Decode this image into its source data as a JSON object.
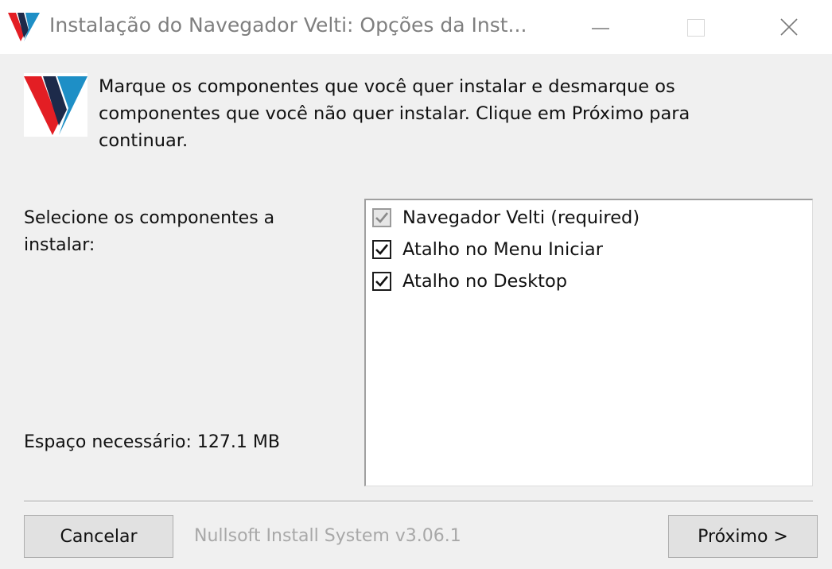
{
  "window": {
    "title": "Instalação do Navegador Velti: Opções da Inst...",
    "icon": "velti-logo-icon",
    "controls": [
      "minimize-icon",
      "maximize-icon",
      "close-icon"
    ]
  },
  "header": {
    "logo": "velti-logo",
    "description": "Marque os componentes que você quer instalar e desmarque os componentes que você não quer instalar. Clique em Próximo para continuar."
  },
  "components": {
    "select_label": "Selecione os componentes a instalar:",
    "space_required": "Espaço necessário: 127.1 MB",
    "items": [
      {
        "label": "Navegador Velti (required)",
        "checked": true,
        "disabled": true
      },
      {
        "label": "Atalho no Menu Iniciar",
        "checked": true,
        "disabled": false
      },
      {
        "label": "Atalho no Desktop",
        "checked": true,
        "disabled": false
      }
    ]
  },
  "footer": {
    "cancel_label": "Cancelar",
    "brand": "Nullsoft Install System v3.06.1",
    "next_label": "Próximo >"
  },
  "colors": {
    "logo_red": "#e31e24",
    "logo_blue": "#1e8fc6",
    "dialog_bg": "#f0f0f0"
  }
}
